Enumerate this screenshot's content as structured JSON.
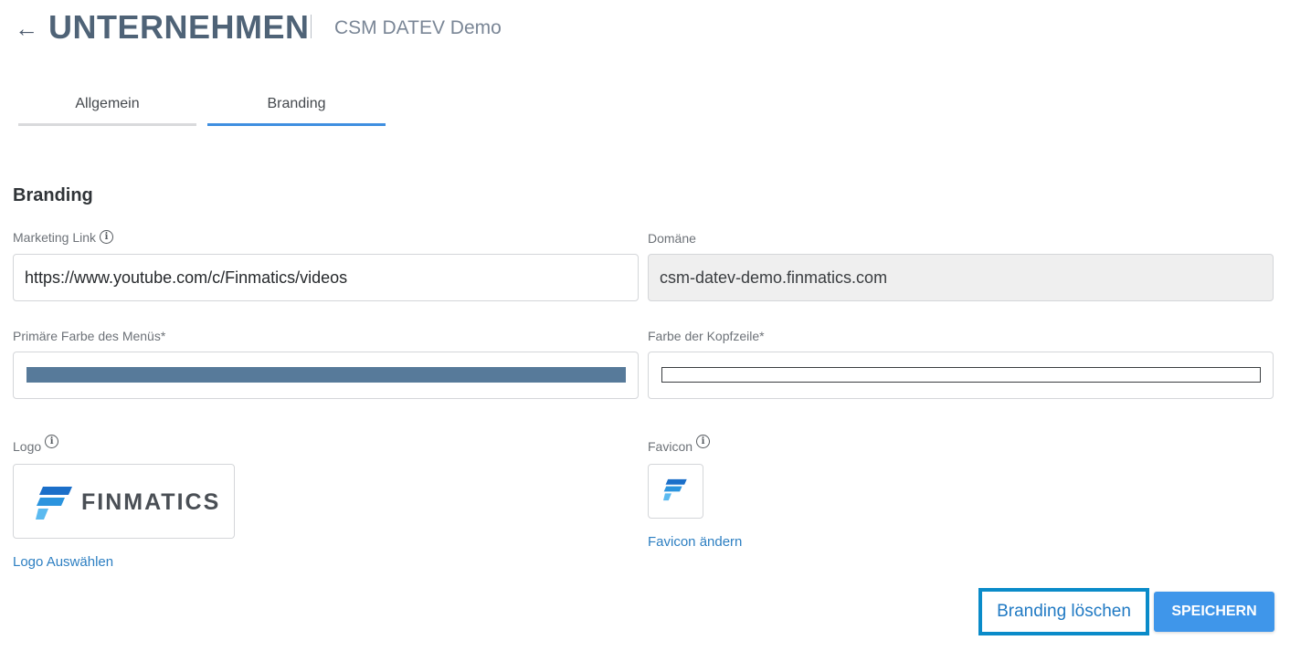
{
  "header": {
    "back_symbol": "←",
    "title": "UNTERNEHMEN",
    "subtitle": "CSM DATEV Demo"
  },
  "tabs": [
    {
      "label": "Allgemein",
      "active": false
    },
    {
      "label": "Branding",
      "active": true
    }
  ],
  "section": {
    "title": "Branding"
  },
  "form": {
    "marketing_link": {
      "label": "Marketing Link",
      "value": "https://www.youtube.com/c/Finmatics/videos"
    },
    "domain": {
      "label": "Domäne",
      "value": "csm-datev-demo.finmatics.com"
    },
    "primary_color": {
      "label": "Primäre Farbe des Menüs*",
      "color": "#577a9a"
    },
    "header_color": {
      "label": "Farbe der Kopfzeile*",
      "color": "#ffffff"
    },
    "logo": {
      "label": "Logo",
      "image_text": "FINMATICS",
      "action": "Logo Auswählen"
    },
    "favicon": {
      "label": "Favicon",
      "action": "Favicon ändern"
    }
  },
  "buttons": {
    "delete_branding": "Branding löschen",
    "save": "SPEICHERN"
  },
  "colors": {
    "accent": "#3f96ea",
    "link": "#2d7fc2",
    "title": "#4f6377"
  },
  "icons": {
    "info": "i"
  }
}
